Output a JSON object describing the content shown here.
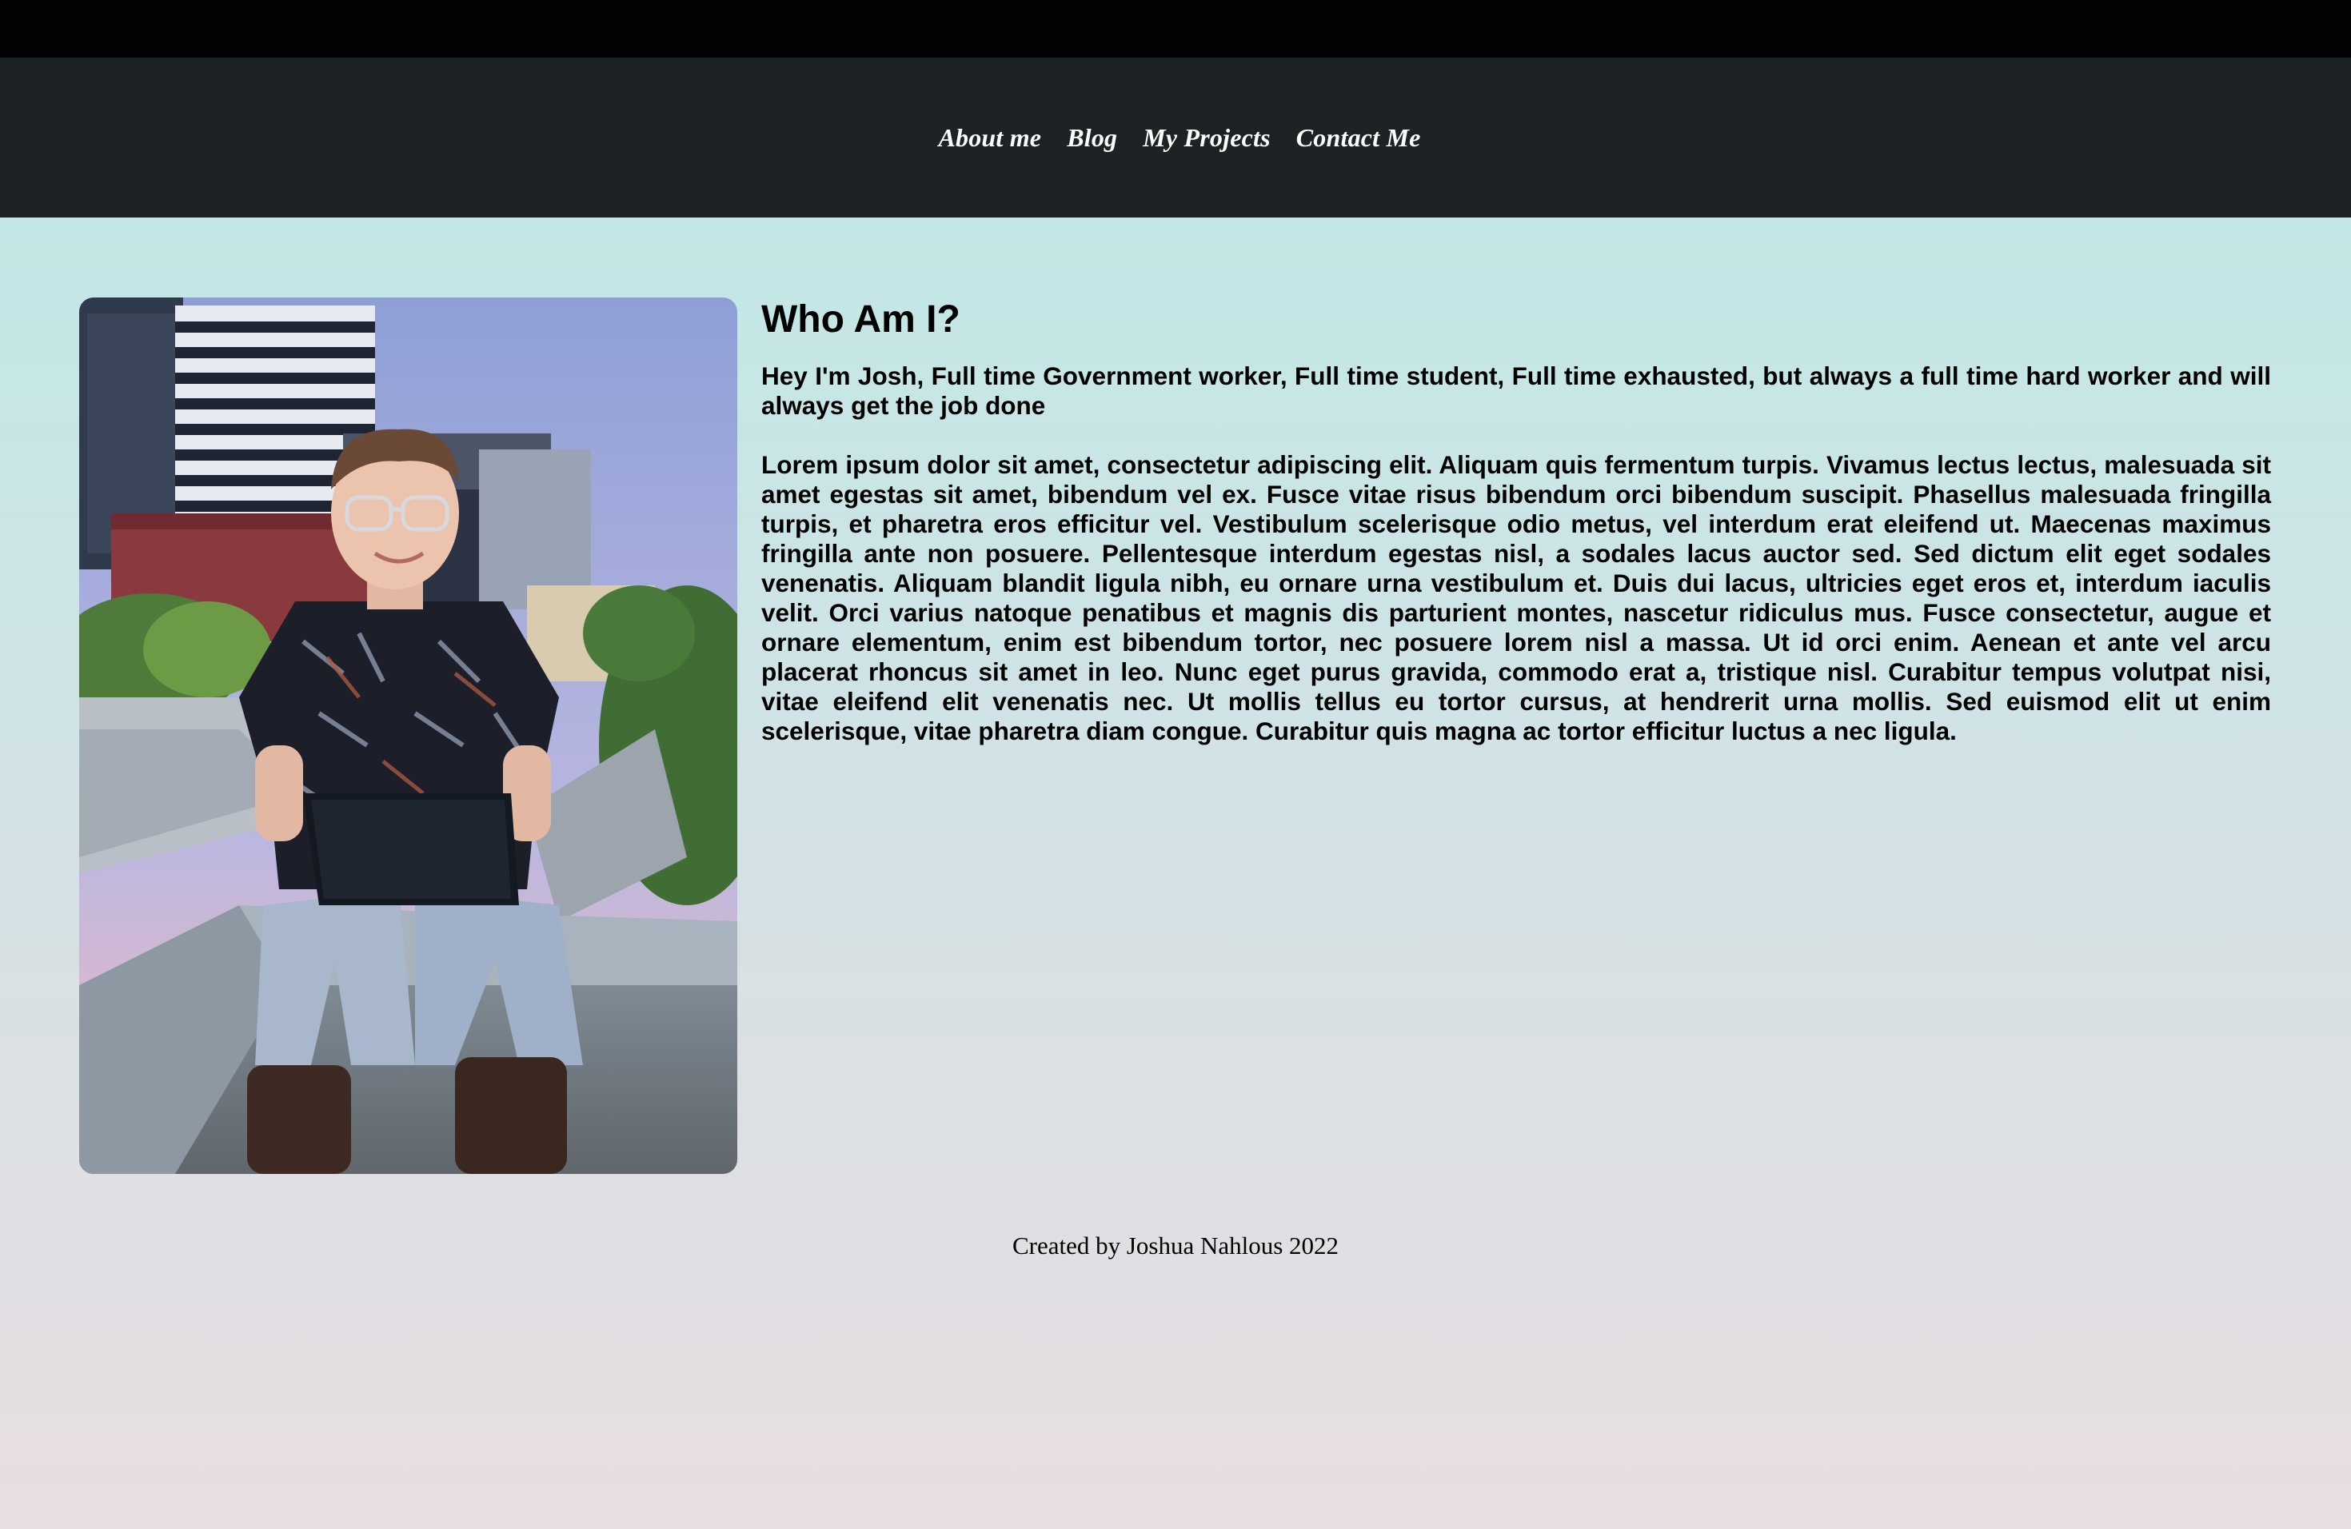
{
  "nav": {
    "items": [
      {
        "label": "About me"
      },
      {
        "label": "Blog"
      },
      {
        "label": "My Projects"
      },
      {
        "label": "Contact Me"
      }
    ]
  },
  "about": {
    "title": "Who Am I?",
    "intro": "Hey I'm Josh, Full time Government worker, Full time student, Full time exhausted, but always a full time hard worker and will always get the job done",
    "body": "Lorem ipsum dolor sit amet, consectetur adipiscing elit. Aliquam quis fermentum turpis. Vivamus lectus lectus, malesuada sit amet egestas sit amet, bibendum vel ex. Fusce vitae risus bibendum orci bibendum suscipit. Phasellus malesuada fringilla turpis, et pharetra eros efficitur vel. Vestibulum scelerisque odio metus, vel interdum erat eleifend ut. Maecenas maximus fringilla ante non posuere. Pellentesque interdum egestas nisl, a sodales lacus auctor sed. Sed dictum elit eget sodales venenatis. Aliquam blandit ligula nibh, eu ornare urna vestibulum et. Duis dui lacus, ultricies eget eros et, interdum iaculis velit. Orci varius natoque penatibus et magnis dis parturient montes, nascetur ridiculus mus. Fusce consectetur, augue et ornare elementum, enim est bibendum tortor, nec posuere lorem nisl a massa. Ut id orci enim. Aenean et ante vel arcu placerat rhoncus sit amet in leo. Nunc eget purus gravida, commodo erat a, tristique nisl. Curabitur tempus volutpat nisi, vitae eleifend elit venenatis nec. Ut mollis tellus eu tortor cursus, at hendrerit urna mollis. Sed euismod elit ut enim scelerisque, vitae pharetra diam congue. Curabitur quis magna ac tortor efficitur luctus a nec ligula."
  },
  "footer": {
    "text": "Created by Joshua Nahlous 2022"
  },
  "colors": {
    "topbar": "#030303",
    "navbar": "#1d2324",
    "nav_text": "#ffffff",
    "bg_top": "#bde9e6",
    "bg_bottom": "#e8dde2"
  }
}
